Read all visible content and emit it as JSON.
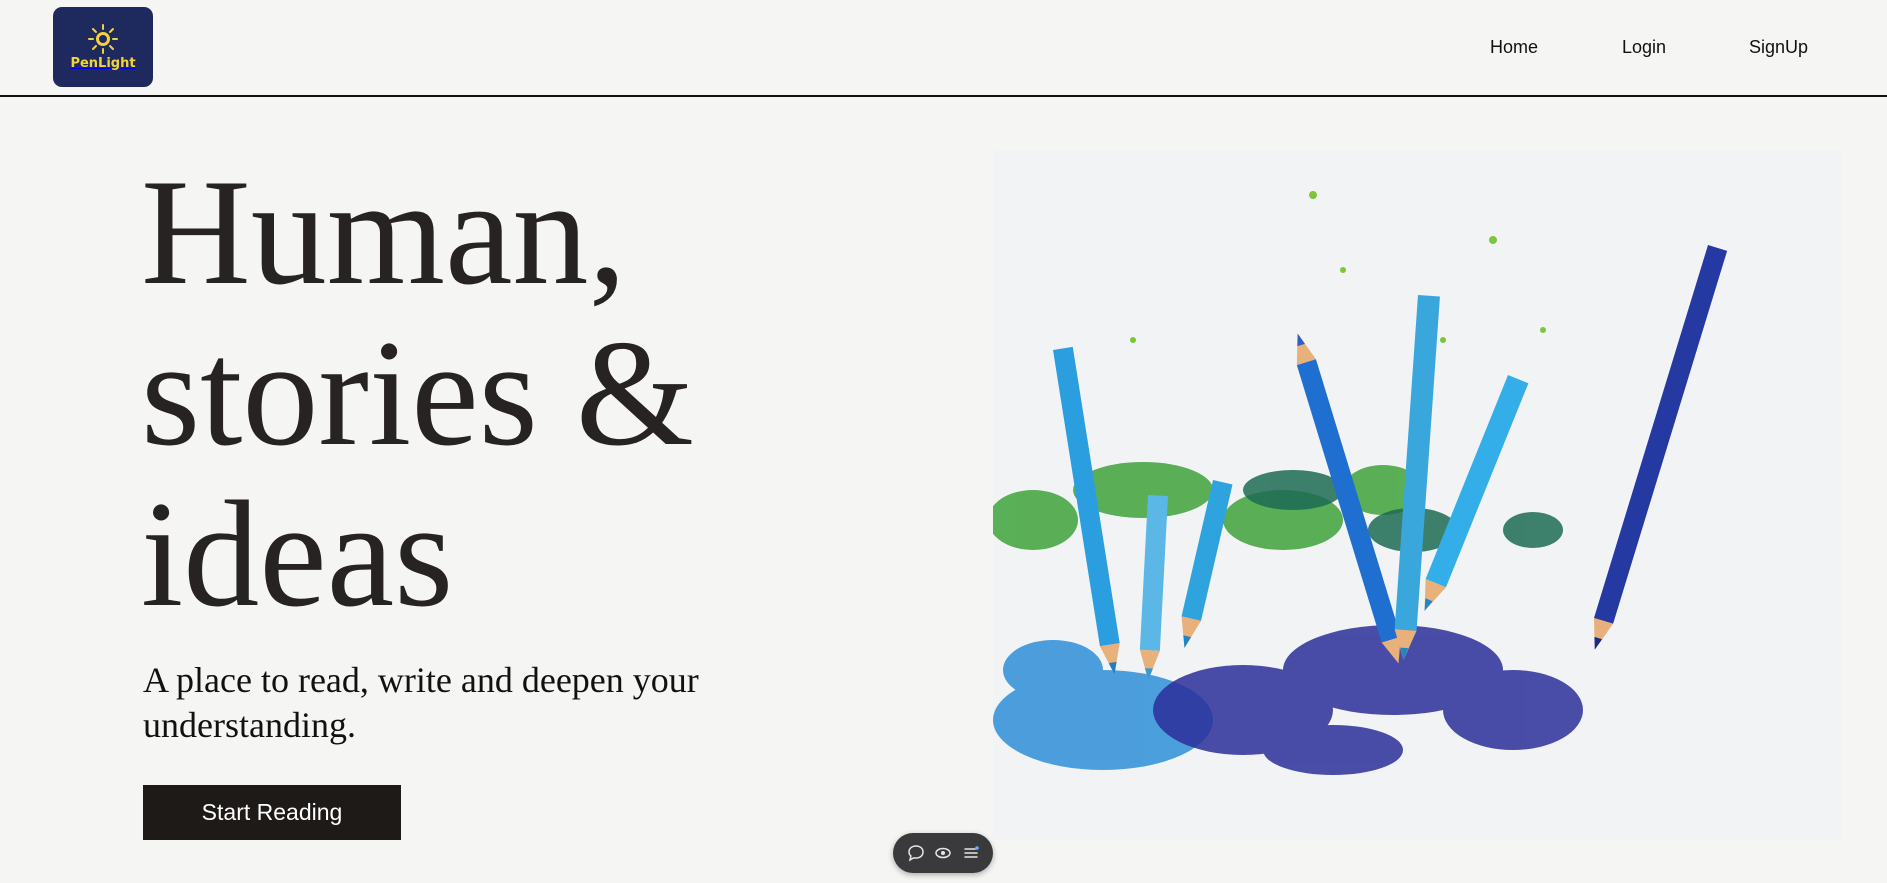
{
  "brand": {
    "name": "PenLight",
    "logo_bg": "#1e2a5e",
    "logo_accent": "#f2d33b"
  },
  "nav": {
    "items": [
      {
        "label": "Home"
      },
      {
        "label": "Login"
      },
      {
        "label": "SignUp"
      }
    ]
  },
  "hero": {
    "title_lines": [
      "Human,",
      "stories &",
      "ideas"
    ],
    "subtitle": "A place to read, write and deepen your understanding.",
    "cta_label": "Start Reading",
    "image": "colored-pencils-and-shavings"
  },
  "floating_toolbar": {
    "icons": [
      "comment-icon",
      "eye-icon",
      "settings-list-icon"
    ]
  },
  "colors": {
    "page_bg": "#f5f5f3",
    "title_text": "#262322",
    "cta_bg": "#1d1a18",
    "cta_text": "#ffffff"
  }
}
